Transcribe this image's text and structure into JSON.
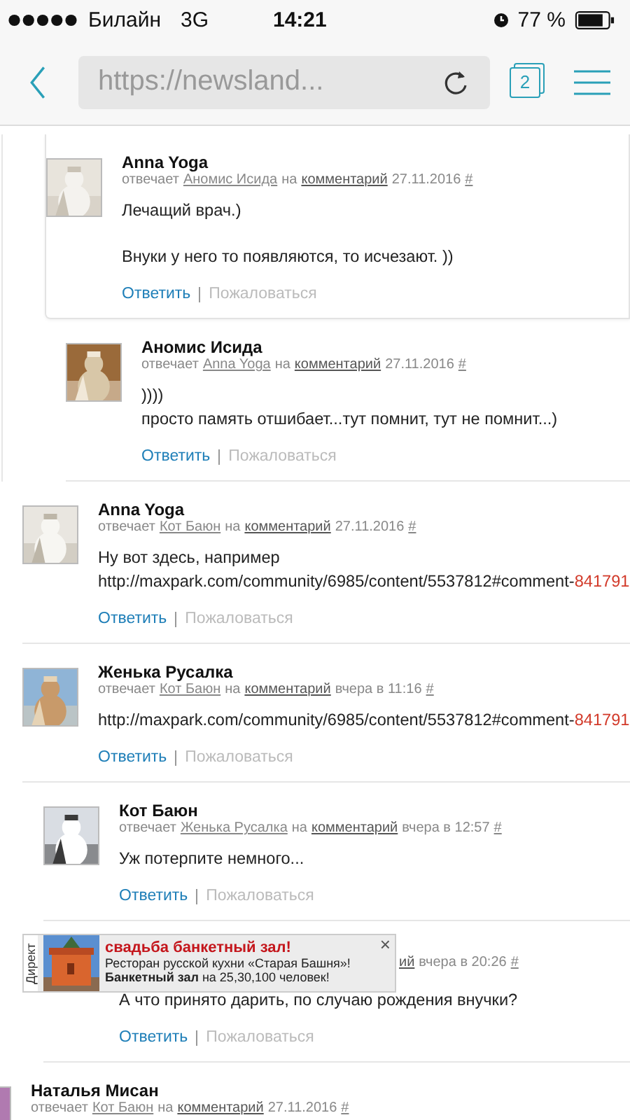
{
  "status_bar": {
    "carrier": "Билайн",
    "network": "3G",
    "time": "14:21",
    "battery": "77 %"
  },
  "browser": {
    "url": "https://newsland...",
    "tab_count": "2"
  },
  "comments": [
    {
      "kind": "thread",
      "children": [
        {
          "kind": "thread",
          "children": [
            {
              "kind": "comment",
              "boxed": true,
              "name": "Anna Yoga",
              "replies": "отвечает",
              "to": "Аномис Исида",
              "on": "на",
              "link": "комментарий",
              "date": "27.11.2016",
              "hash": "#",
              "body": [
                [
                  "Лечащий врач.)"
                ],
                [
                  "Внуки у него то появляются, то исчезают. ))"
                ]
              ],
              "reply": "Ответить",
              "report": "Пожаловаться",
              "children": [
                {
                  "kind": "comment",
                  "boxed": false,
                  "name": "Аномис Исида",
                  "replies": "отвечает",
                  "to": "Anna Yoga",
                  "on": "на",
                  "link": "комментарий",
                  "date": "27.11.2016",
                  "hash": "#",
                  "body": [
                    [
                      "))))",
                      "просто память отшибает...тут помнит, тут не помнит...)"
                    ]
                  ],
                  "reply": "Ответить",
                  "report": "Пожаловаться"
                }
              ]
            }
          ]
        },
        {
          "kind": "comment",
          "boxed": false,
          "name": "Anna Yoga",
          "replies": "отвечает",
          "to": "Кот Баюн",
          "on": "на",
          "link": "комментарий",
          "date": "27.11.2016",
          "hash": "#",
          "body": [
            [
              "Ну вот здесь, например",
              {
                "text": "http://maxpark.com/community/6985/content/5537812#comment-",
                "accent": "841791"
              }
            ]
          ],
          "reply": "Ответить",
          "report": "Пожаловаться"
        },
        {
          "kind": "comment",
          "boxed": false,
          "name": "Женька Русалка",
          "replies": "отвечает",
          "to": "Кот Баюн",
          "on": "на",
          "link": "комментарий",
          "date": "вчера в 11:16",
          "hash": "#",
          "body": [
            [
              {
                "text": "http://maxpark.com/community/6985/content/5537812#comment-",
                "accent": "841791"
              }
            ]
          ],
          "reply": "Ответить",
          "report": "Пожаловаться",
          "children": [
            {
              "kind": "comment",
              "boxed": false,
              "name": "Кот Баюн",
              "replies": "отвечает",
              "to": "Женька Русалка",
              "on": "на",
              "link": "комментарий",
              "date": "вчера в 12:57",
              "hash": "#",
              "body": [
                [
                  "Уж потерпите немного..."
                ]
              ],
              "reply": "Ответить",
              "report": "Пожаловаться"
            },
            {
              "kind": "covered",
              "boxed": false,
              "link": "ий",
              "date": "вчера в 20:26",
              "hash": "#",
              "body": [
                [
                  "А что принято дарить, по случаю рождения внучки?"
                ]
              ],
              "reply": "Ответить",
              "report": "Пожаловаться"
            }
          ]
        }
      ]
    },
    {
      "kind": "comment",
      "boxed": false,
      "name": "Наталья Мисан",
      "replies": "отвечает",
      "to": "Кот Баюн",
      "on": "на",
      "link": "комментарий",
      "date": "27.11.2016",
      "hash": "#"
    }
  ],
  "ad": {
    "label": "Директ",
    "title": "свадьба банкетный зал!",
    "line": "Ресторан русской кухни «Старая Башня»!",
    "line2": "**Банкетный зал** на 25,30,100 человек!",
    "close": "×"
  }
}
